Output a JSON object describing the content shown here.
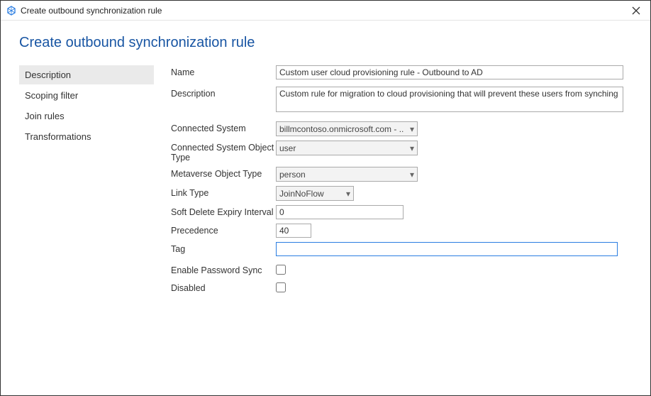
{
  "window": {
    "title": "Create outbound synchronization rule"
  },
  "page": {
    "heading": "Create outbound synchronization rule"
  },
  "sidebar": {
    "items": [
      {
        "label": "Description",
        "active": true
      },
      {
        "label": "Scoping filter",
        "active": false
      },
      {
        "label": "Join rules",
        "active": false
      },
      {
        "label": "Transformations",
        "active": false
      }
    ]
  },
  "form": {
    "name_label": "Name",
    "name_value": "Custom user cloud provisioning rule - Outbound to AD",
    "description_label": "Description",
    "description_value": "Custom rule for migration to cloud provisioning that will prevent these users from synching",
    "connected_system_label": "Connected System",
    "connected_system_value": "billmcontoso.onmicrosoft.com - ..",
    "cs_object_type_label": "Connected System Object Type",
    "cs_object_type_value": "user",
    "mv_object_type_label": "Metaverse Object Type",
    "mv_object_type_value": "person",
    "link_type_label": "Link Type",
    "link_type_value": "JoinNoFlow",
    "soft_delete_label": "Soft Delete Expiry Interval",
    "soft_delete_value": "0",
    "precedence_label": "Precedence",
    "precedence_value": "40",
    "tag_label": "Tag",
    "tag_value": "",
    "enable_pw_sync_label": "Enable Password Sync",
    "enable_pw_sync_checked": false,
    "disabled_label": "Disabled",
    "disabled_checked": false
  }
}
